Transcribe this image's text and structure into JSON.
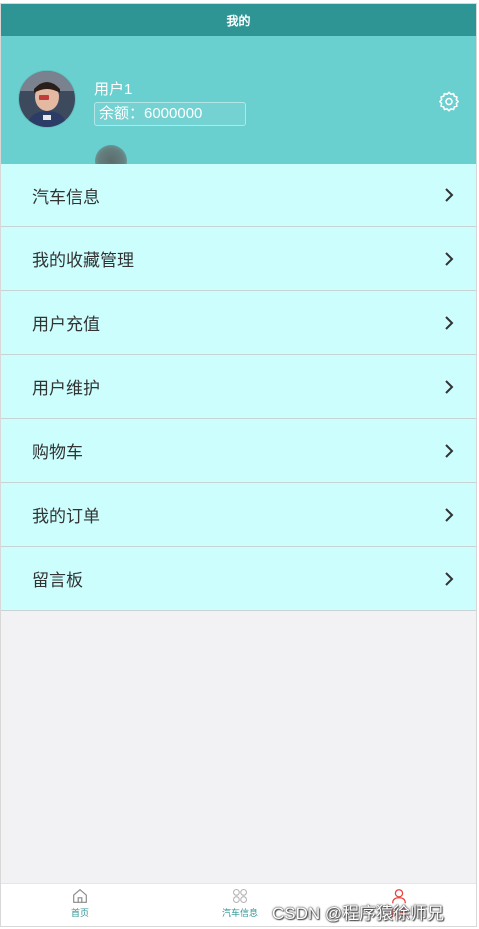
{
  "titlebar": {
    "title": "我的"
  },
  "profile": {
    "username": "用户1",
    "balance": "余额：6000000",
    "settings_icon": "gear-icon"
  },
  "menu": {
    "items": [
      {
        "label": "汽车信息"
      },
      {
        "label": "我的收藏管理"
      },
      {
        "label": "用户充值"
      },
      {
        "label": "用户维护"
      },
      {
        "label": "购物车"
      },
      {
        "label": "我的订单"
      },
      {
        "label": "留言板"
      }
    ]
  },
  "tabbar": {
    "tabs": [
      {
        "label": "首页",
        "icon": "home-icon",
        "color": "#2f9494"
      },
      {
        "label": "汽车信息",
        "icon": "grid-icon",
        "color": "#2f9494"
      },
      {
        "label": "我的",
        "icon": "user-icon",
        "color": "#e8443a"
      }
    ]
  },
  "watermark": {
    "text": "CSDN @程序猿徐师兄"
  },
  "colors": {
    "titlebar": "#2f9494",
    "profile_bg": "#69cfcf",
    "menu_bg": "#ccfefe",
    "page_bg": "#f2f1f3"
  }
}
